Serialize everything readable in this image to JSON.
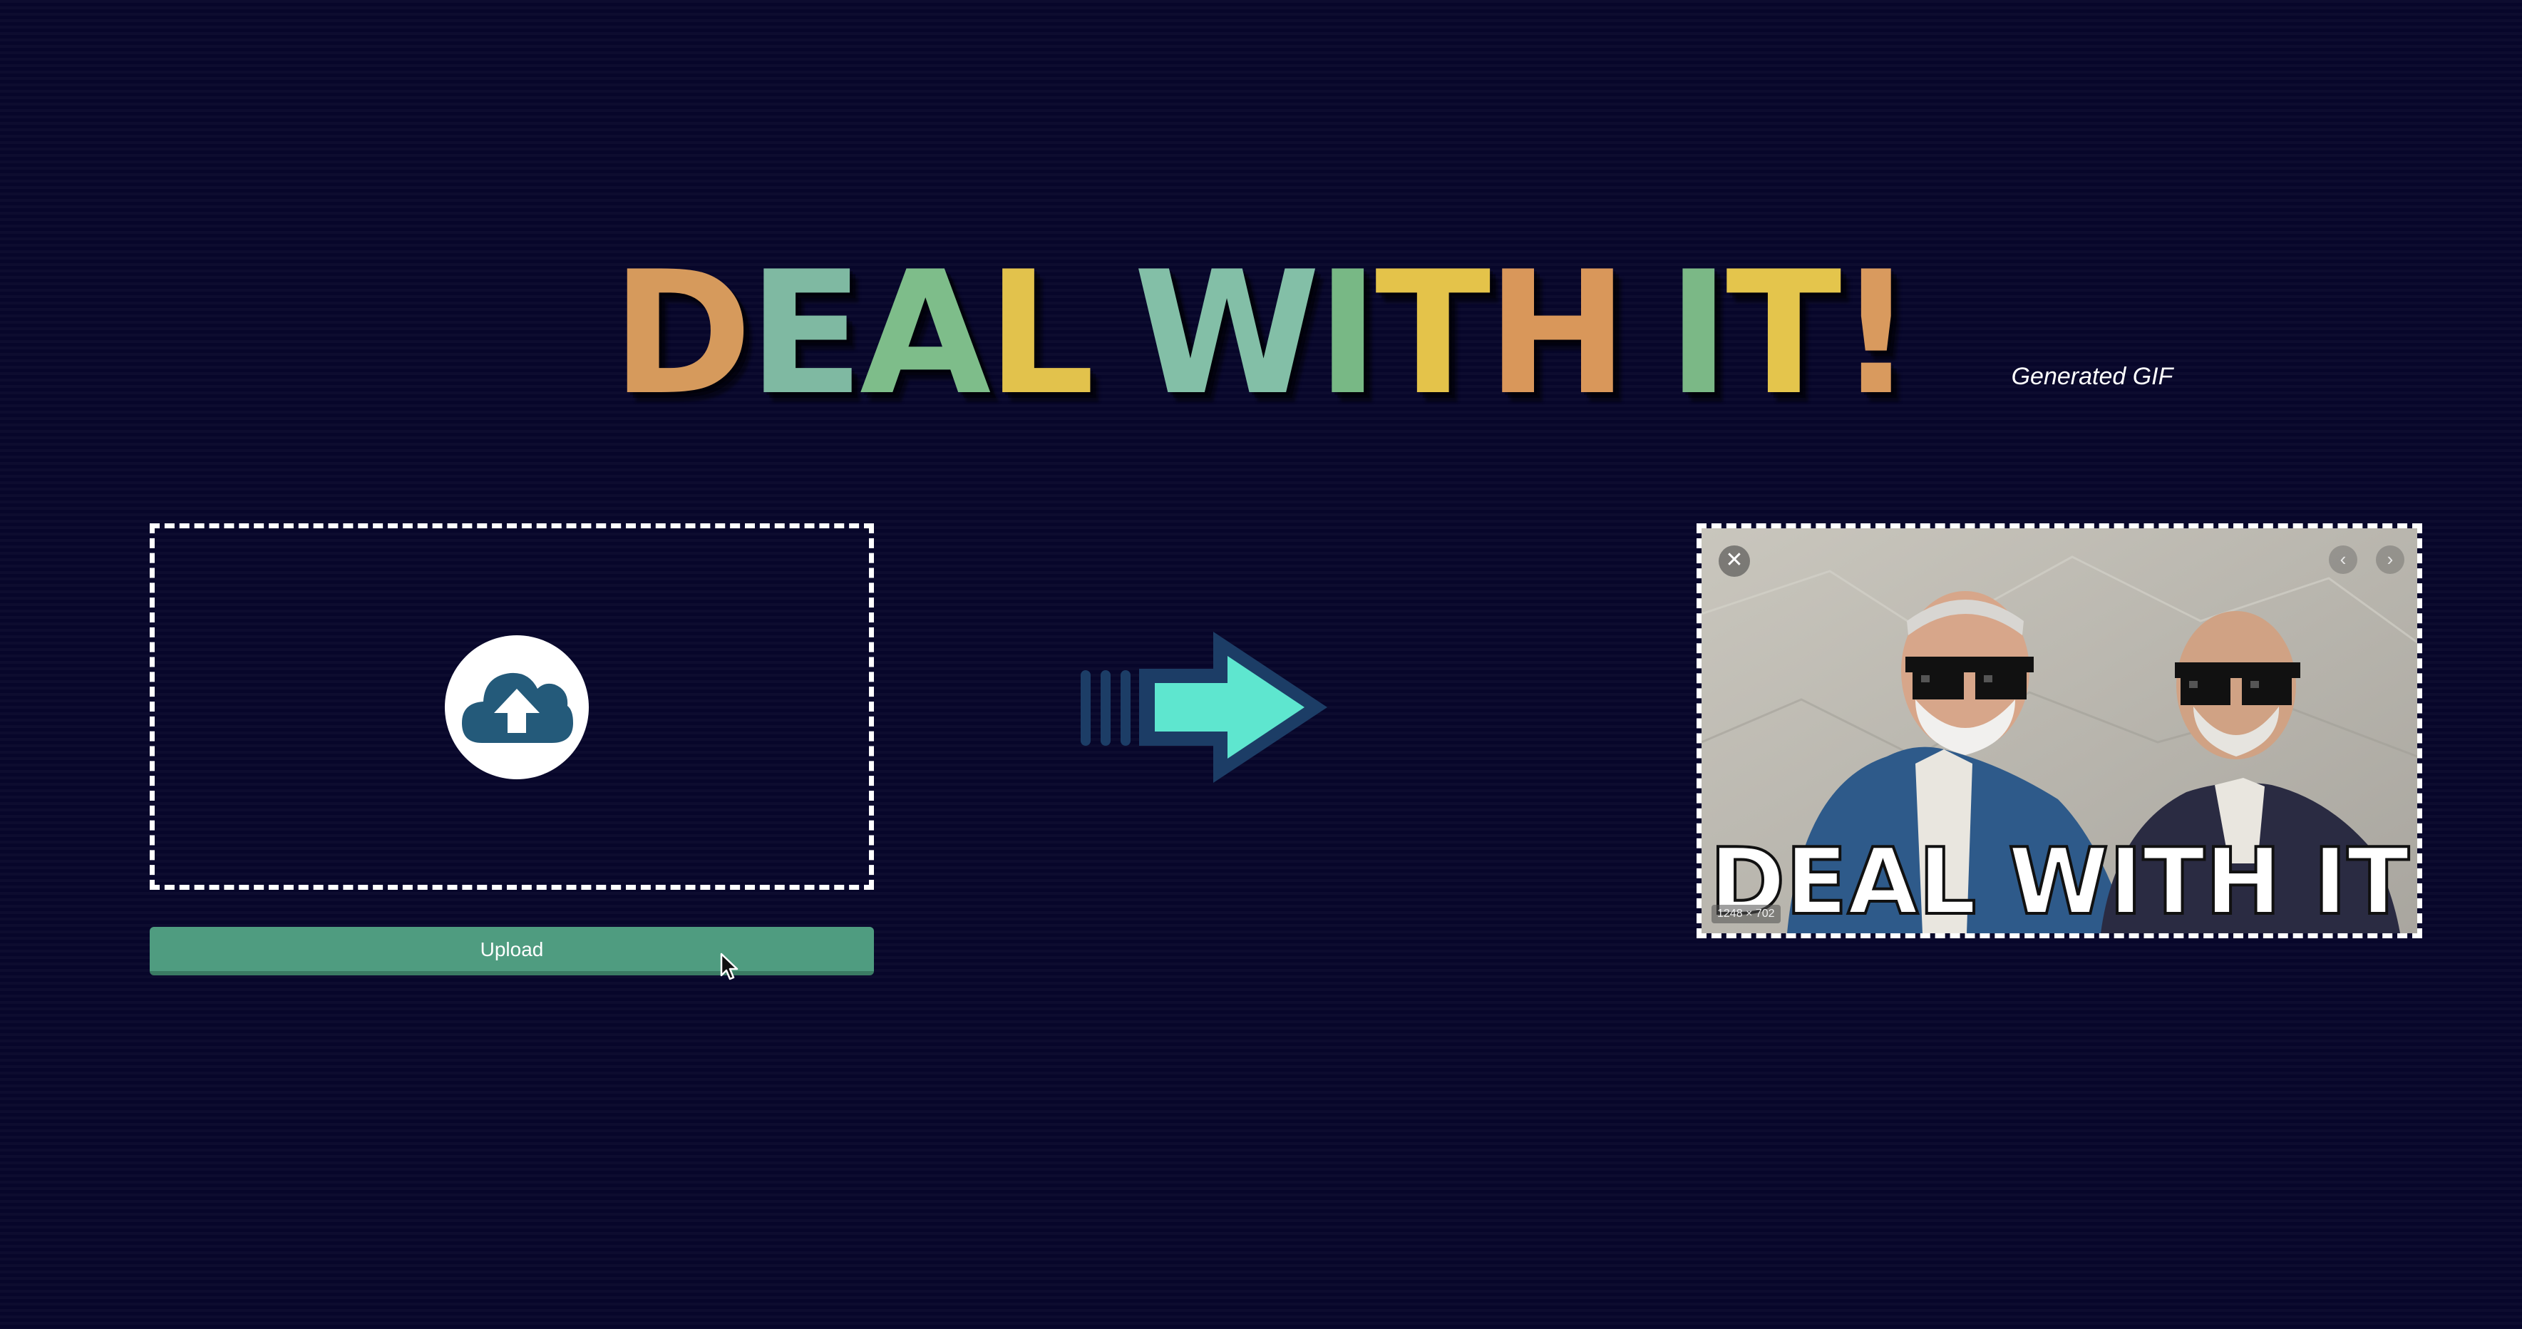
{
  "title": {
    "letters": [
      {
        "char": "D",
        "color": "#d69a5c"
      },
      {
        "char": "E",
        "color": "#7fb9a2"
      },
      {
        "char": "A",
        "color": "#7ebd8a"
      },
      {
        "char": "L",
        "color": "#e2c24c"
      },
      {
        "char": " ",
        "color": ""
      },
      {
        "char": "W",
        "color": "#83bfa7"
      },
      {
        "char": "I",
        "color": "#78b885"
      },
      {
        "char": "T",
        "color": "#e4c34a"
      },
      {
        "char": "H",
        "color": "#d9975a"
      },
      {
        "char": " ",
        "color": ""
      },
      {
        "char": "I",
        "color": "#7bb886"
      },
      {
        "char": "T",
        "color": "#e4c54c"
      },
      {
        "char": "!",
        "color": "#d99a5e"
      }
    ]
  },
  "caption": "Generated GIF",
  "upload": {
    "button_label": "Upload",
    "icon": "cloud-upload-icon"
  },
  "arrow_icon": "arrow-right-icon",
  "result": {
    "meme_text": "DEAL WITH IT",
    "dimensions_label": "1248 × 702",
    "close_glyph": "✕",
    "prev_glyph": "‹",
    "next_glyph": "›"
  },
  "colors": {
    "background": "#07062a",
    "upload_button": "#4f9c80",
    "upload_icon": "#245a7a",
    "arrow_fill": "#5ee6cf",
    "arrow_outline": "#1c3d66"
  }
}
